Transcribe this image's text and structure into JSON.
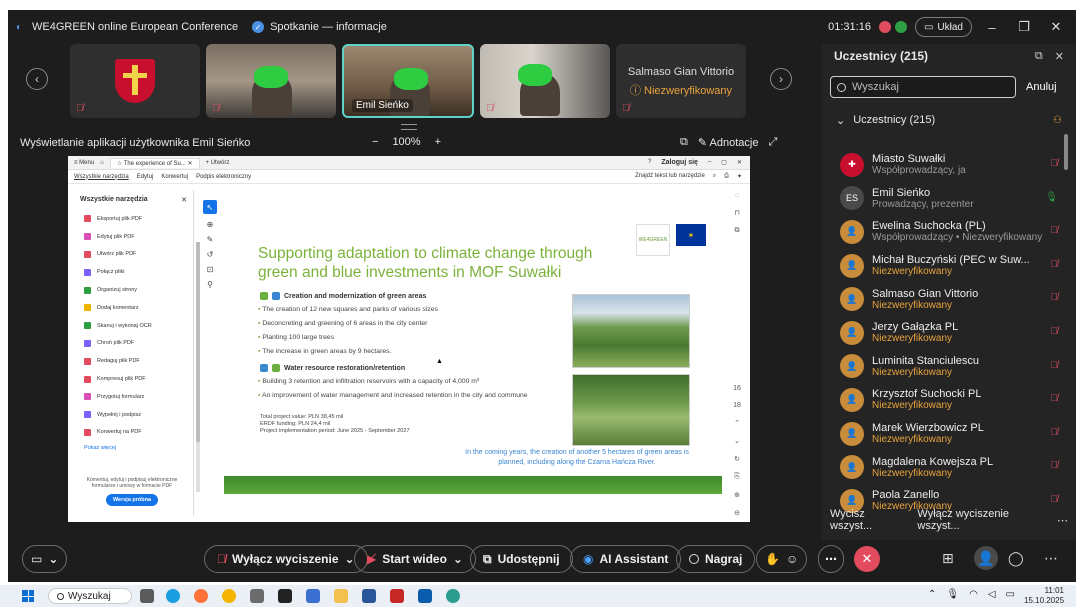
{
  "window": {
    "app_name": "WE4GREEN online European Conference",
    "meeting_info": "Spotkanie — informacje",
    "timer": "01:31:16",
    "layout_label": "Układ"
  },
  "video_strip": {
    "tiles": [
      {
        "kind": "emblem"
      },
      {
        "kind": "video"
      },
      {
        "kind": "video",
        "name": "Emil Sieńko",
        "active": true
      },
      {
        "kind": "video"
      },
      {
        "kind": "name",
        "name": "Salmaso Gian Vittorio",
        "status": "Niezweryfikowany"
      }
    ]
  },
  "share_bar": {
    "title": "Wyświetlanie aplikacji użytkownika Emil Sieńko",
    "zoom": "100%",
    "annotations": "Adnotacje"
  },
  "pdf_viewer": {
    "tab_menu": "Menu",
    "tab_title": "The experience of Su...",
    "tab_new": "Utwórz",
    "login": "Zaloguj się",
    "menu_items": [
      "Wszystkie narzędzia",
      "Edytuj",
      "Konwertuj",
      "Podpis elektroniczny"
    ],
    "find": "Znajdź tekst lub narzędzie",
    "tools_title": "Wszystkie narzędzia",
    "tools": [
      "Eksportuj plik PDF",
      "Edytuj plik PDF",
      "Utwórz plik PDF",
      "Połącz pliki",
      "Organizuj strony",
      "Dodaj komentarz",
      "Skanuj i wykonaj OCR",
      "Chroń plik PDF",
      "Redaguj plik PDF",
      "Kompresuj plik PDF",
      "Przygotuj formularz",
      "Wypełnij i podpisz",
      "Konwertuj na PDF"
    ],
    "more": "Pokaż więcej",
    "promo_text": "Komentuj, edytuj i podpisuj elektroniczne formularze i umowy w formacie PDF",
    "trial_button": "Wersja próbna",
    "page_numbers": [
      "16",
      "18"
    ]
  },
  "slide": {
    "title": "Supporting adaptation to climate change through green and blue investments in MOF Suwałki",
    "logo_text": "WE4GREEN",
    "section1": "Creation and modernization of green areas",
    "bullets1": [
      "The creation of 12 new squares and parks of various sizes",
      "Deconcreting and greening of 6 areas in the city center",
      "Planting 100 large trees",
      "The increase in green areas by 9 hectares."
    ],
    "section2": "Water resource restoration/retention",
    "bullets2": [
      "Building 3 retention and infiltration reservoirs with a capacity of 4,000 m³",
      "An improvement of water management and increased retention in the city and commune"
    ],
    "project_lines": [
      "Total project value: PLN 38,45 mil",
      "ERDF funding: PLN 24,4 mil",
      "Project implementation period: June 2025 - September 2027"
    ],
    "note": "In the coming years, the creation of another 5 hectares of green areas is planned, including along the Czarna Hańcza River."
  },
  "participants": {
    "title": "Uczestnicy (215)",
    "search_placeholder": "Wyszukaj",
    "cancel": "Anuluj",
    "section": "Uczestnicy (215)",
    "list": [
      {
        "name": "Miasto Suwałki",
        "role": "Współprowadzący, ja",
        "unverified": false,
        "avatar": "crest",
        "mic": "muted"
      },
      {
        "name": "Emil Sieńko",
        "role": "Prowadzący, prezenter",
        "unverified": false,
        "avatar": "ES",
        "mic": "on"
      },
      {
        "name": "Ewelina Suchocka (PL)",
        "role": "Współprowadzący • Niezweryfikowany",
        "unverified": true,
        "avatar": "user",
        "mic": "muted"
      },
      {
        "name": "Michał Buczyński (PEC w Suw...",
        "role": "Niezweryfikowany",
        "unverified": true,
        "avatar": "user",
        "mic": "muted"
      },
      {
        "name": "Salmaso Gian Vittorio",
        "role": "Niezweryfikowany",
        "unverified": true,
        "avatar": "user",
        "mic": "muted"
      },
      {
        "name": "Jerzy Gałązka PL",
        "role": "Niezweryfikowany",
        "unverified": true,
        "avatar": "user",
        "mic": "muted"
      },
      {
        "name": "Luminita Stanciulescu",
        "role": "Niezweryfikowany",
        "unverified": true,
        "avatar": "user",
        "mic": "muted"
      },
      {
        "name": "Krzysztof Suchocki PL",
        "role": "Niezweryfikowany",
        "unverified": true,
        "avatar": "user",
        "mic": "muted"
      },
      {
        "name": "Marek Wierzbowicz PL",
        "role": "Niezweryfikowany",
        "unverified": true,
        "avatar": "user",
        "mic": "muted"
      },
      {
        "name": "Magdalena Kowejsza PL",
        "role": "Niezweryfikowany",
        "unverified": true,
        "avatar": "user",
        "mic": "muted"
      },
      {
        "name": "Paola Zanello",
        "role": "Niezweryfikowany",
        "unverified": true,
        "avatar": "user",
        "mic": "muted"
      }
    ],
    "mute_all": "Wycisz wszyst...",
    "unmute_all": "Wyłącz wyciszenie wszyst..."
  },
  "toolbar": {
    "unmute": "Wyłącz wyciszenie",
    "start_video": "Start wideo",
    "share": "Udostępnij",
    "ai_assistant": "AI Assistant",
    "record": "Nagraj"
  },
  "taskbar": {
    "search": "Wyszukaj",
    "time": "11:01",
    "date": "15.10.2025"
  },
  "colors": {
    "accent_red": "#e34c5f",
    "unverified": "#e8a33d",
    "slide_green": "#7bb23b",
    "slide_blue": "#3a86d4",
    "active_border": "#5fd3c8"
  }
}
